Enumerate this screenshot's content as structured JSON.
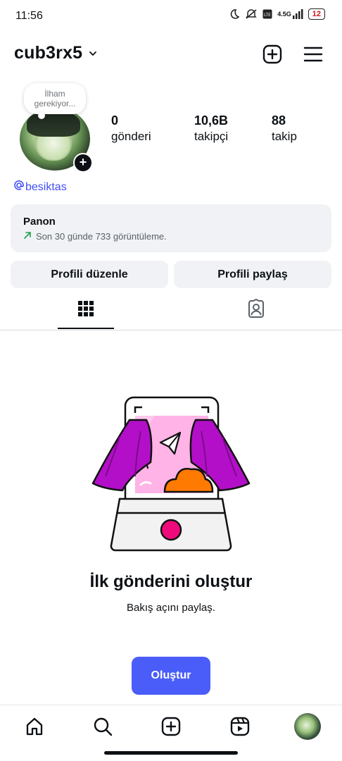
{
  "status_bar": {
    "time": "11:56",
    "network": "4.5G",
    "battery": "12"
  },
  "header": {
    "username": "cub3rx5"
  },
  "profile": {
    "note_bubble": [
      "İlham",
      "gerekiyor..."
    ],
    "stats": [
      {
        "value": "0",
        "label": "gönderi"
      },
      {
        "value": "10,6B",
        "label": "takipçi"
      },
      {
        "value": "88",
        "label": "takip"
      }
    ],
    "linked_handle": "besiktas"
  },
  "dashboard": {
    "title": "Panon",
    "subtitle": "Son 30 günde 733 görüntüleme."
  },
  "actions": {
    "edit_profile": "Profili düzenle",
    "share_profile": "Profili paylaş"
  },
  "empty_state": {
    "title": "İlk gönderini oluştur",
    "subtitle": "Bakış açını paylaş.",
    "button": "Oluştur"
  },
  "colors": {
    "accent": "#4a5df9",
    "link": "#4150f7",
    "curtain": "#b30fc8",
    "pink": "#ee0a7b",
    "orange": "#ff7a00"
  },
  "icons": {
    "header": [
      "plus-square-icon",
      "menu-icon"
    ],
    "tabs": [
      "grid-icon",
      "tagged-icon"
    ],
    "nav": [
      "home-icon",
      "search-icon",
      "create-icon",
      "reels-icon",
      "profile-avatar"
    ]
  }
}
